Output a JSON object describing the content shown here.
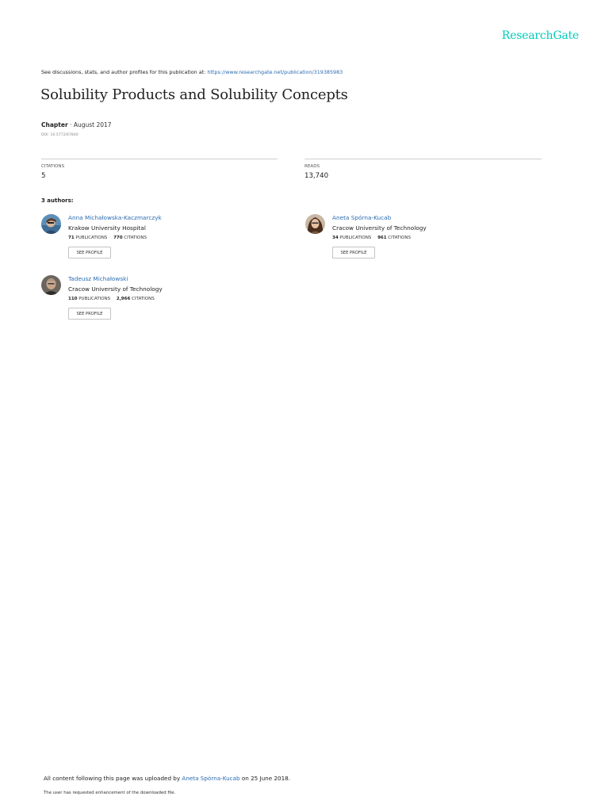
{
  "brand": {
    "logo_text": "ResearchGate",
    "accent_color": "#00ccbb",
    "link_color": "#2b6cb3"
  },
  "intro": {
    "prefix": "See discussions, stats, and author profiles for this publication at:",
    "url": "https://www.researchgate.net/publication/319385983"
  },
  "publication": {
    "title": "Solubility Products and Solubility Concepts",
    "type": "Chapter",
    "separator": " · ",
    "date": "August 2017",
    "doi": "DOI: 10.5772/67840"
  },
  "stats": {
    "citations_label": "CITATIONS",
    "citations_value": "5",
    "reads_label": "READS",
    "reads_value": "13,740"
  },
  "authors_heading": "3 authors:",
  "authors": [
    {
      "name": "Anna Michałowska-Kaczmarczyk",
      "institution": "Krakow University Hospital",
      "publications": "71",
      "publications_label": "PUBLICATIONS",
      "citations": "770",
      "citations_label": "CITATIONS",
      "button_label": "SEE PROFILE"
    },
    {
      "name": "Aneta Spórna-Kucab",
      "institution": "Cracow University of Technology",
      "publications": "34",
      "publications_label": "PUBLICATIONS",
      "citations": "961",
      "citations_label": "CITATIONS",
      "button_label": "SEE PROFILE"
    },
    {
      "name": "Tadeusz Michałowski",
      "institution": "Cracow University of Technology",
      "publications": "110",
      "publications_label": "PUBLICATIONS",
      "citations": "2,966",
      "citations_label": "CITATIONS",
      "button_label": "SEE PROFILE"
    }
  ],
  "footer": {
    "upload_prefix": "All content following this page was uploaded by",
    "uploader": "Aneta Spórna-Kucab",
    "upload_suffix": "on 25 June 2018.",
    "note": "The user has requested enhancement of the downloaded file."
  }
}
